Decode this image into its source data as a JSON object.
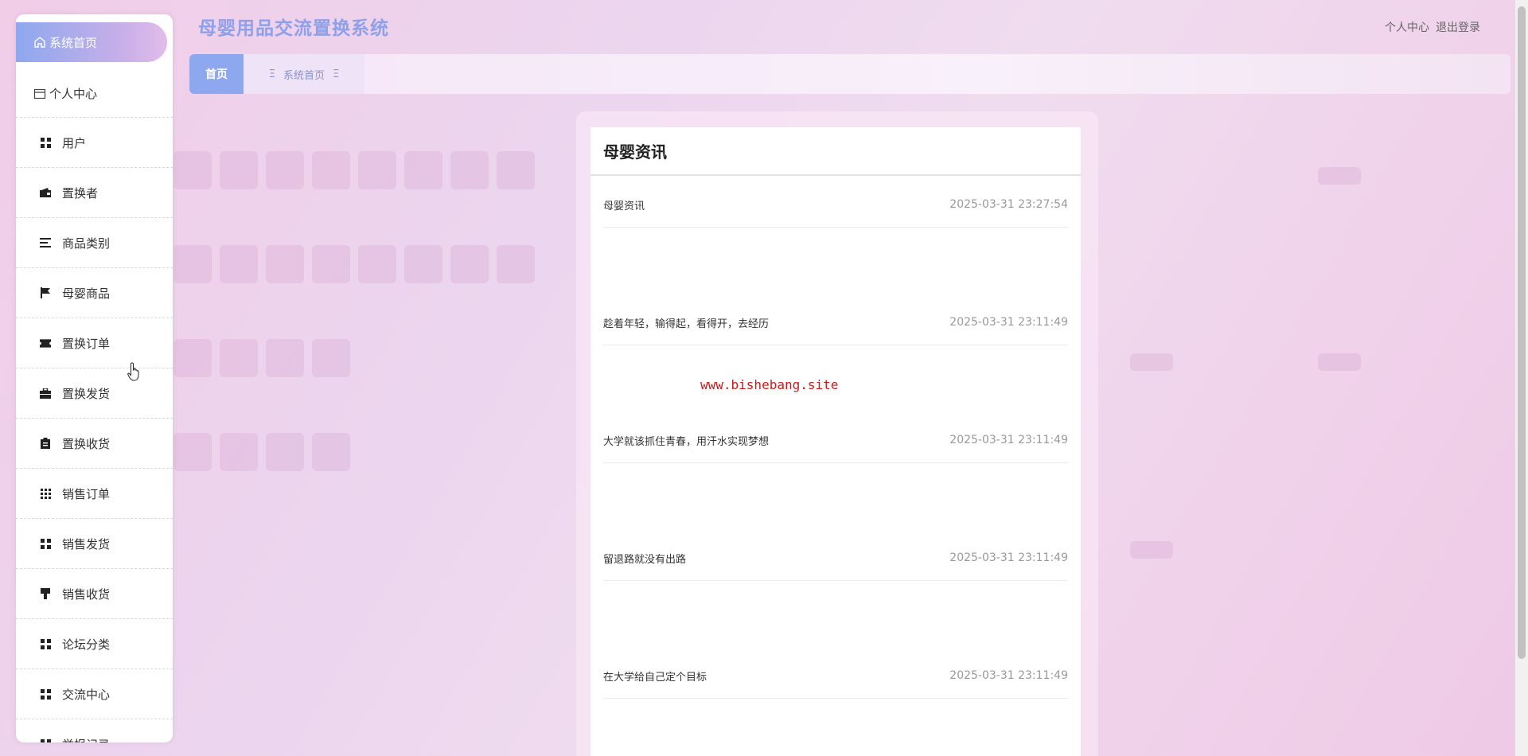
{
  "app": {
    "title": "母婴用品交流置换系统"
  },
  "header": {
    "profile_link": "个人中心",
    "logout_link": "退出登录"
  },
  "sidebar": {
    "home_label": "系统首页",
    "profile_label": "个人中心",
    "items": [
      {
        "label": "用户",
        "icon": "grid-icon"
      },
      {
        "label": "置换者",
        "icon": "wallet-icon"
      },
      {
        "label": "商品类别",
        "icon": "list-icon"
      },
      {
        "label": "母婴商品",
        "icon": "flag-icon"
      },
      {
        "label": "置换订单",
        "icon": "ticket-icon"
      },
      {
        "label": "置换发货",
        "icon": "briefcase-icon"
      },
      {
        "label": "置换收货",
        "icon": "clipboard-icon"
      },
      {
        "label": "销售订单",
        "icon": "apps-icon"
      },
      {
        "label": "销售发货",
        "icon": "grid-icon"
      },
      {
        "label": "销售收货",
        "icon": "brush-icon"
      },
      {
        "label": "论坛分类",
        "icon": "grid-icon"
      },
      {
        "label": "交流中心",
        "icon": "grid-icon"
      },
      {
        "label": "举报记录",
        "icon": "grid-icon"
      }
    ]
  },
  "tabs": {
    "active": "首页",
    "current": "系统首页",
    "current_icon": "Ξ"
  },
  "news": {
    "title": "母婴资讯",
    "items": [
      {
        "title": "母婴资讯",
        "date": "2025-03-31 23:27:54"
      },
      {
        "title": "趁着年轻，输得起，看得开，去经历",
        "date": "2025-03-31 23:11:49"
      },
      {
        "title": "大学就该抓住青春，用汗水实现梦想",
        "date": "2025-03-31 23:11:49"
      },
      {
        "title": "留退路就没有出路",
        "date": "2025-03-31 23:11:49"
      },
      {
        "title": "在大学给自己定个目标",
        "date": "2025-03-31 23:11:49"
      }
    ]
  },
  "watermark": "www.bishebang.site"
}
